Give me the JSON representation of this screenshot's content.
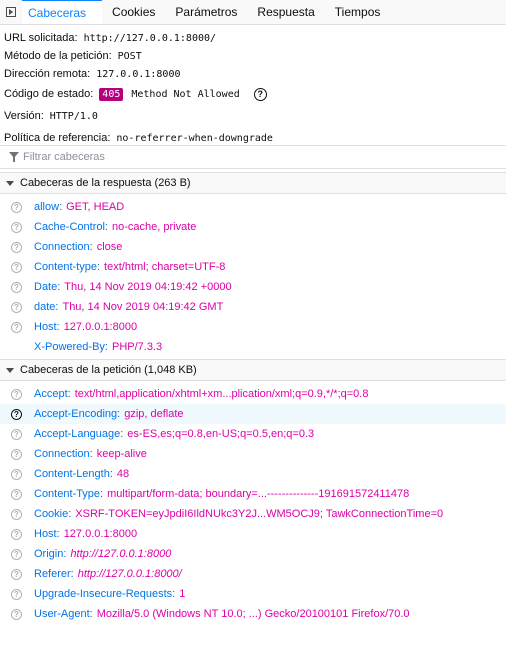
{
  "tabs": [
    {
      "label": "Cabeceras",
      "active": true
    },
    {
      "label": "Cookies",
      "active": false
    },
    {
      "label": "Parámetros",
      "active": false
    },
    {
      "label": "Respuesta",
      "active": false
    },
    {
      "label": "Tiempos",
      "active": false
    }
  ],
  "summary": {
    "url_label": "URL solicitada:",
    "url_value": "http://127.0.0.1:8000/",
    "method_label": "Método de la petición:",
    "method_value": "POST",
    "remote_label": "Dirección remota:",
    "remote_value": "127.0.0.1:8000",
    "status_label": "Código de estado:",
    "status_code": "405",
    "status_text": "Method Not Allowed",
    "version_label": "Versión:",
    "version_value": "HTTP/1.0",
    "referrer_label": "Política de referencia:",
    "referrer_value": "no-referrer-when-downgrade"
  },
  "filter": {
    "placeholder": "Filtrar cabeceras"
  },
  "response_section": {
    "title": "Cabeceras de la respuesta (263 B)",
    "headers": [
      {
        "name": "allow:",
        "value": "GET, HEAD"
      },
      {
        "name": "Cache-Control:",
        "value": "no-cache, private"
      },
      {
        "name": "Connection:",
        "value": "close"
      },
      {
        "name": "Content-type:",
        "value": "text/html; charset=UTF-8"
      },
      {
        "name": "Date:",
        "value": "Thu, 14 Nov 2019 04:19:42 +0000"
      },
      {
        "name": "date:",
        "value": "Thu, 14 Nov 2019 04:19:42 GMT"
      },
      {
        "name": "Host:",
        "value": "127.0.0.1:8000"
      },
      {
        "name": "X-Powered-By:",
        "value": "PHP/7.3.3"
      }
    ]
  },
  "request_section": {
    "title": "Cabeceras de la petición (1,048 KB)",
    "headers": [
      {
        "name": "Accept:",
        "value": "text/html,application/xhtml+xm...plication/xml;q=0.9,*/*;q=0.8"
      },
      {
        "name": "Accept-Encoding:",
        "value": "gzip, deflate"
      },
      {
        "name": "Accept-Language:",
        "value": "es-ES,es;q=0.8,en-US;q=0.5,en;q=0.3"
      },
      {
        "name": "Connection:",
        "value": "keep-alive"
      },
      {
        "name": "Content-Length:",
        "value": "48"
      },
      {
        "name": "Content-Type:",
        "value": "multipart/form-data; boundary=...--------------191691572411478"
      },
      {
        "name": "Cookie:",
        "value": "XSRF-TOKEN=eyJpdiI6IldNUkc3Y2J...WM5OCJ9; TawkConnectionTime=0"
      },
      {
        "name": "Host:",
        "value": "127.0.0.1:8000"
      },
      {
        "name": "Origin:",
        "value": "http://127.0.0.1:8000"
      },
      {
        "name": "Referer:",
        "value": "http://127.0.0.1:8000/"
      },
      {
        "name": "Upgrade-Insecure-Requests:",
        "value": "1"
      },
      {
        "name": "User-Agent:",
        "value": "Mozilla/5.0 (Windows NT 10.0; ...) Gecko/20100101 Firefox/70.0"
      }
    ]
  }
}
